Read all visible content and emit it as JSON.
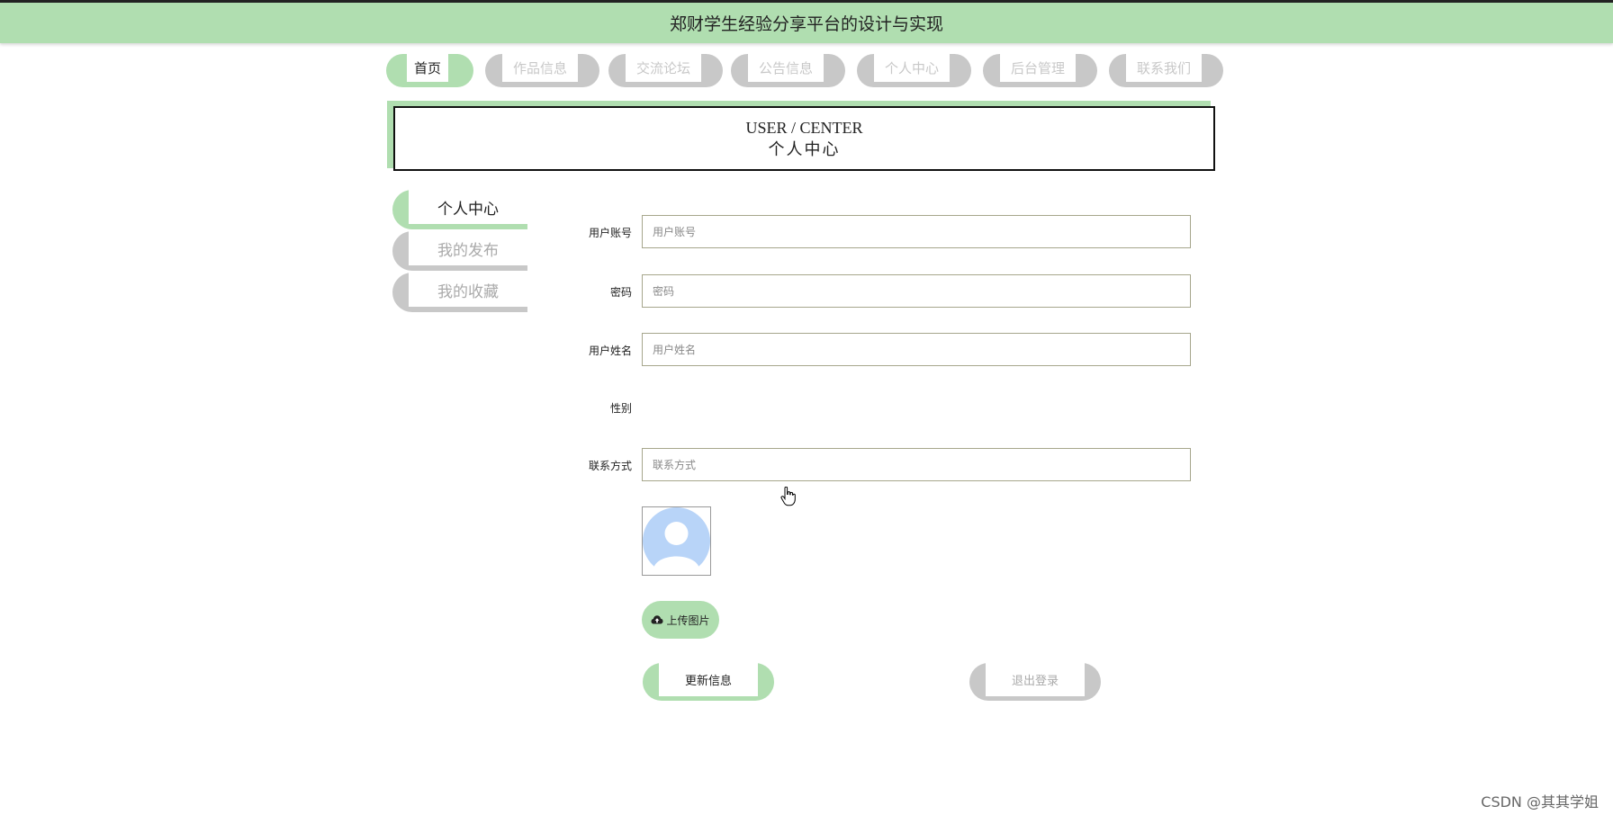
{
  "header": {
    "title": "郑财学生经验分享平台的设计与实现"
  },
  "nav": {
    "items": [
      {
        "label": "首页"
      },
      {
        "label": "作品信息"
      },
      {
        "label": "交流论坛"
      },
      {
        "label": "公告信息"
      },
      {
        "label": "个人中心"
      },
      {
        "label": "后台管理"
      },
      {
        "label": "联系我们"
      }
    ],
    "active": "首页"
  },
  "page_title": {
    "en": "USER / CENTER",
    "cn": "个人中心"
  },
  "sidebar": {
    "items": [
      {
        "label": "个人中心"
      },
      {
        "label": "我的发布"
      },
      {
        "label": "我的收藏"
      }
    ],
    "active": "个人中心"
  },
  "form": {
    "account": {
      "label": "用户账号",
      "placeholder": "用户账号",
      "value": ""
    },
    "password": {
      "label": "密码",
      "placeholder": "密码",
      "value": ""
    },
    "name": {
      "label": "用户姓名",
      "placeholder": "用户姓名",
      "value": ""
    },
    "gender": {
      "label": "性别"
    },
    "contact": {
      "label": "联系方式",
      "placeholder": "联系方式",
      "value": ""
    },
    "upload_label": "上传图片",
    "update_label": "更新信息",
    "logout_label": "退出登录"
  },
  "watermark": "CSDN @其其学姐",
  "colors": {
    "accent": "#b0deb0",
    "inactive": "#c8c8c8",
    "avatar": "#b8d4f8"
  },
  "icons": {
    "upload": "cloud-upload-icon",
    "cursor": "hand-pointer-icon",
    "avatar": "user-silhouette-icon"
  }
}
